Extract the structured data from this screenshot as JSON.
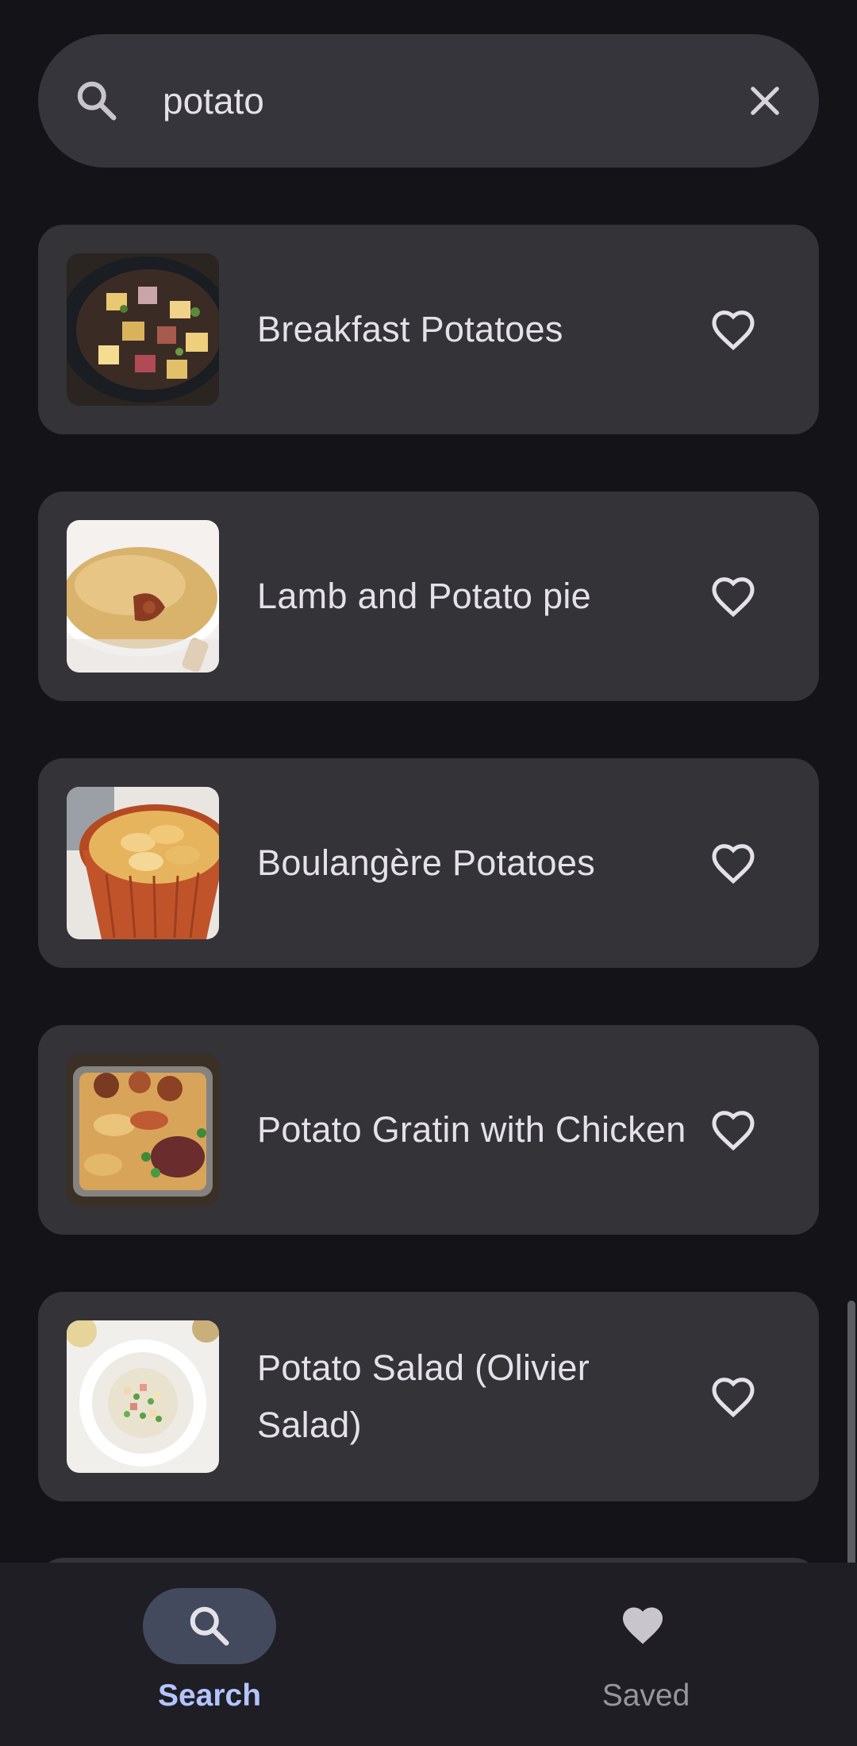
{
  "search": {
    "value": "potato",
    "placeholder": "Search recipes"
  },
  "results": [
    {
      "title": "Breakfast Potatoes",
      "favorite": false
    },
    {
      "title": "Lamb and Potato pie",
      "favorite": false
    },
    {
      "title": "Boulangère Potatoes",
      "favorite": false
    },
    {
      "title": "Potato Gratin with Chicken",
      "favorite": false
    },
    {
      "title": "Potato Salad (Olivier Salad)",
      "favorite": false
    }
  ],
  "nav": {
    "search_label": "Search",
    "saved_label": "Saved",
    "active_tab": "Search"
  },
  "icons": {
    "search": "search-icon",
    "clear": "close-icon",
    "favorite": "heart-outline-icon",
    "saved": "heart-filled-icon"
  },
  "colors": {
    "background": "#131318",
    "surface": "#333338",
    "search_bar": "#35353b",
    "accent": "#b4c4ff",
    "nav_pill": "#434a5e"
  }
}
